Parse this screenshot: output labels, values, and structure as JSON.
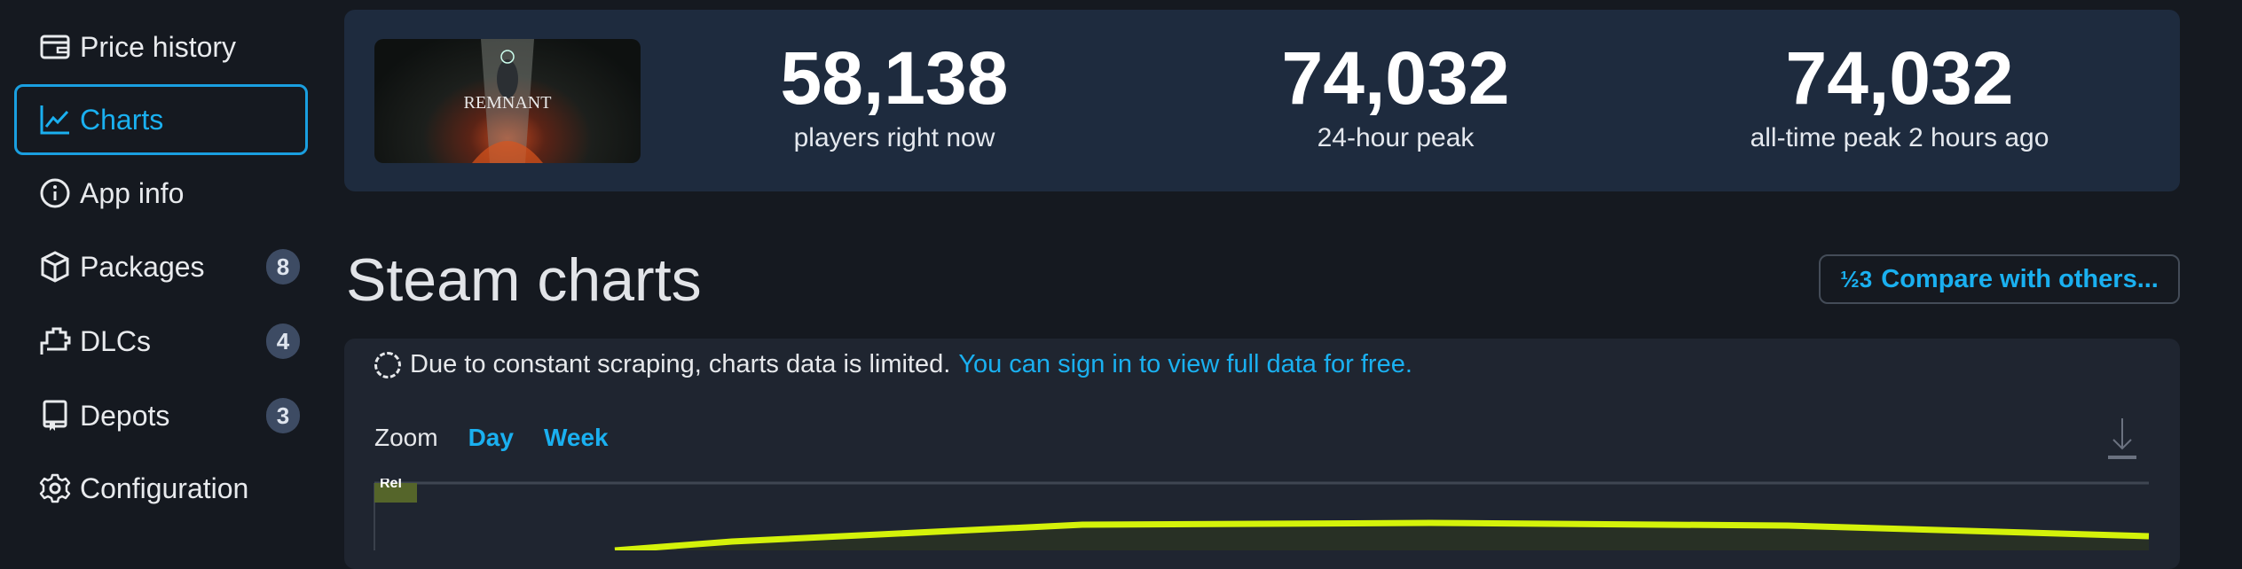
{
  "sidebar": {
    "items": [
      {
        "label": "Price history",
        "icon": "wallet-icon"
      },
      {
        "label": "Charts",
        "icon": "chart-line-icon",
        "active": true
      },
      {
        "label": "App info",
        "icon": "info-icon"
      },
      {
        "label": "Packages",
        "icon": "box-icon",
        "badge": "8"
      },
      {
        "label": "DLCs",
        "icon": "puzzle-icon",
        "badge": "4"
      },
      {
        "label": "Depots",
        "icon": "book-icon",
        "badge": "3"
      },
      {
        "label": "Configuration",
        "icon": "gear-icon"
      }
    ]
  },
  "header_card": {
    "game_logo_text": "REMNANT",
    "stats": [
      {
        "value": "58,138",
        "label": "players right now"
      },
      {
        "value": "74,032",
        "label": "24-hour peak"
      },
      {
        "value": "74,032",
        "label": "all-time peak 2 hours ago"
      }
    ]
  },
  "page_title": "Steam charts",
  "compare_button": {
    "icon_text": "½3",
    "label": "Compare with others..."
  },
  "chart_panel": {
    "notice": "Due to constant scraping, charts data is limited.",
    "notice_link": "You can sign in to view full data for free.",
    "zoom_label": "Zoom",
    "zoom_options": [
      "Day",
      "Week"
    ],
    "release_flag": "Rel",
    "line_color": "#d4f20a",
    "accent": "#1ab0f0"
  }
}
